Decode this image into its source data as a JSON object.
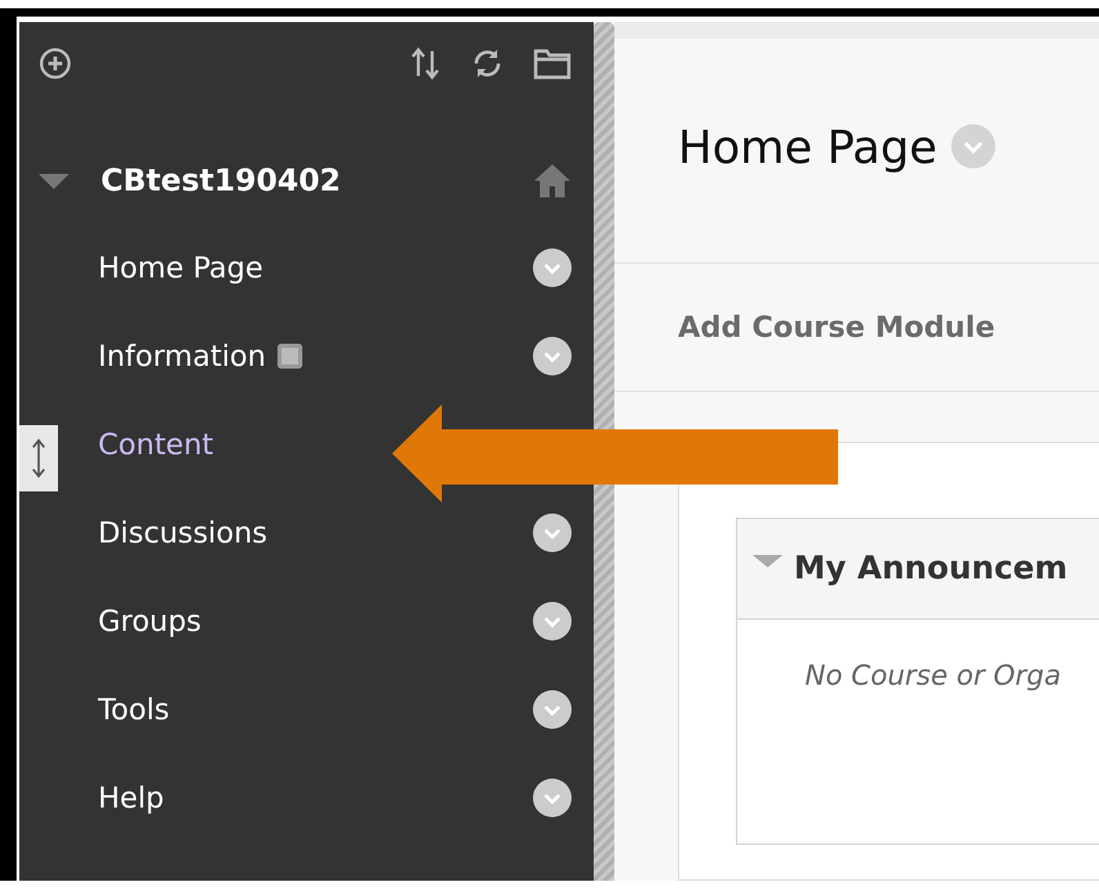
{
  "course": {
    "title": "CBtest190402",
    "expanded": true
  },
  "menu": [
    {
      "label": "Home Page",
      "kind": "plain",
      "selected": false
    },
    {
      "label": "Information",
      "kind": "with-icon",
      "selected": false
    },
    {
      "label": "Content",
      "kind": "plain",
      "selected": true
    },
    {
      "label": "Discussions",
      "kind": "plain",
      "selected": false
    },
    {
      "label": "Groups",
      "kind": "plain",
      "selected": false
    },
    {
      "label": "Tools",
      "kind": "plain",
      "selected": false
    },
    {
      "label": "Help",
      "kind": "plain",
      "selected": false
    }
  ],
  "page": {
    "title": "Home Page",
    "add_module": "Add Course Module"
  },
  "modules": [
    {
      "title": "My Announcem",
      "expanded": true,
      "message": "No Course or Orga"
    }
  ]
}
